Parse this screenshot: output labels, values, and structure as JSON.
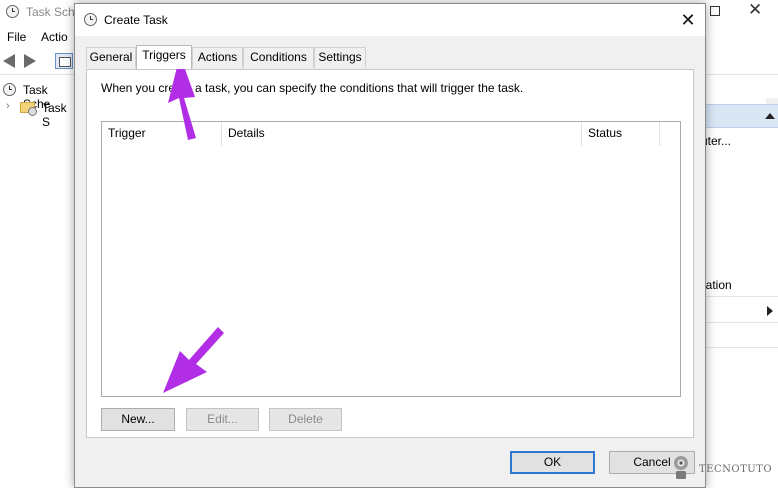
{
  "background_window": {
    "title": "Task Sche",
    "menu": [
      "File",
      "Actio"
    ],
    "tree": [
      "Task Sche",
      "Task S"
    ],
    "actions_panel": [
      "uter...",
      "uration"
    ]
  },
  "dialog": {
    "title": "Create Task",
    "close_glyph": "✕",
    "tabs": [
      "General",
      "Triggers",
      "Actions",
      "Conditions",
      "Settings"
    ],
    "active_tab": "Triggers",
    "description": "When you create a task, you can specify the conditions that will trigger the task.",
    "table": {
      "columns": [
        "Trigger",
        "Details",
        "Status"
      ],
      "rows": []
    },
    "buttons": {
      "new": "New...",
      "edit": "Edit...",
      "delete": "Delete",
      "ok": "OK",
      "cancel": "Cancel"
    }
  },
  "watermark": "TECNOTUTO",
  "colors": {
    "annotation_arrow": "#b12ee6",
    "default_button_border": "#2f78d4",
    "actions_header": "#d9e7f5"
  },
  "icons": [
    "clock-icon",
    "back-arrow-icon",
    "forward-arrow-icon",
    "console-tree-icon",
    "folder-clock-icon",
    "close-icon",
    "chevron-right-icon",
    "collapse-triangle-icon",
    "expand-triangle-icon"
  ]
}
